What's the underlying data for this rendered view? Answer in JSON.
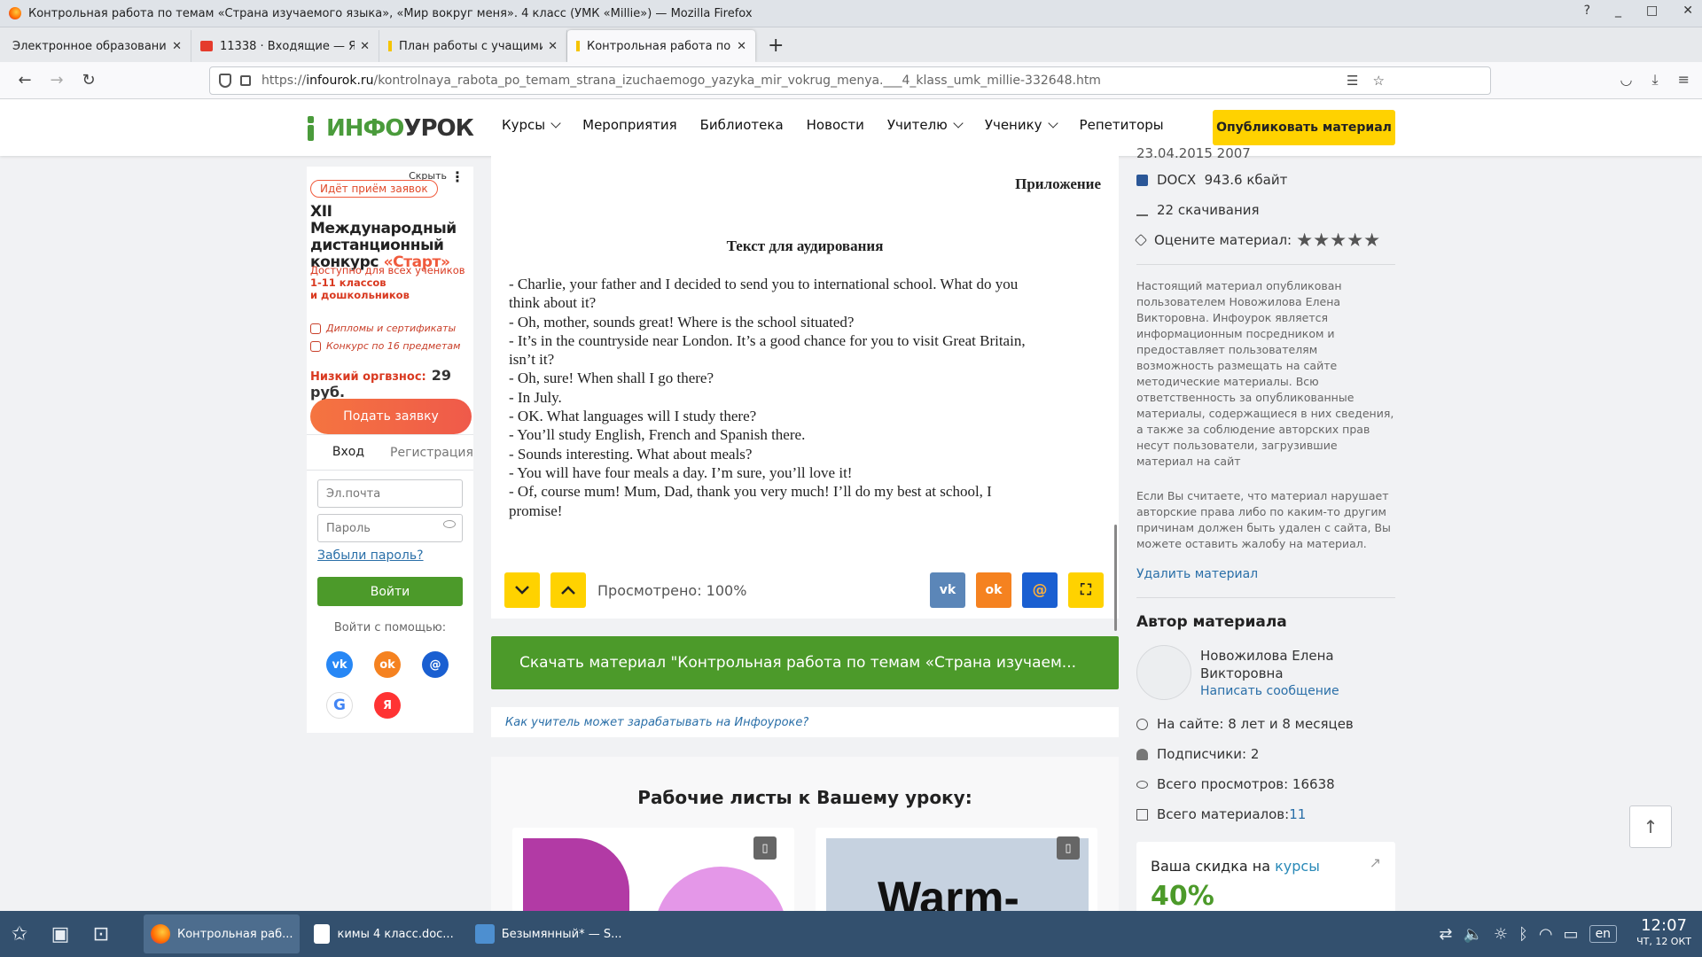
{
  "window": {
    "title": "Контрольная работа по темам «Страна изучаемого языка», «Мир вокруг меня». 4 класс (УМК «Millie») — Mozilla Firefox"
  },
  "tabs": [
    {
      "label": "Электронное образование Р",
      "active": false
    },
    {
      "label": "11338 · Входящие — Яндекс",
      "active": false
    },
    {
      "label": "План работы с учащимися",
      "active": false
    },
    {
      "label": "Контрольная работа по т",
      "active": true
    }
  ],
  "url": {
    "prefix": "https://",
    "host": "infourok.ru",
    "path": "/kontrolnaya_rabota_po_temam_strana_izuchaemogo_yazyka_mir_vokrug_menya.___4_klass_umk_millie-332648.htm"
  },
  "header": {
    "logo_left": "ИНФО",
    "logo_right": "УРОК",
    "menu": [
      {
        "label": "Курсы",
        "dropdown": true
      },
      {
        "label": "Мероприятия",
        "dropdown": false
      },
      {
        "label": "Библиотека",
        "dropdown": false
      },
      {
        "label": "Новости",
        "dropdown": false
      },
      {
        "label": "Учителю",
        "dropdown": true
      },
      {
        "label": "Ученику",
        "dropdown": true
      },
      {
        "label": "Репетиторы",
        "dropdown": false
      }
    ],
    "publish": "Опубликовать материал"
  },
  "ad": {
    "hide": "Скрыть",
    "pill": "Идёт приём заявок",
    "title_1": "XII Международный дистанционный конкурс ",
    "title_accent": "«Старт»",
    "avail_1": "Доступно для всех учеников",
    "avail_2": "1-11 классов",
    "avail_3": "и дошкольников",
    "feature_1": "Дипломы и сертификаты",
    "feature_2": "Конкурс по 16 предметам",
    "fee_label": "Низкий оргвзнос:",
    "fee_value": "29 руб.",
    "apply": "Подать заявку"
  },
  "login": {
    "tab_login": "Вход",
    "tab_register": "Регистрация",
    "email_placeholder": "Эл.почта",
    "password_placeholder": "Пароль",
    "forgot": "Забыли пароль?",
    "submit": "Войти",
    "via": "Войти с помощью:"
  },
  "document": {
    "appendix": "Приложение",
    "title": "Текст для аудирования",
    "lines": [
      "- Charlie, your father and I decided to send you to international school. What do you",
      "think about it?",
      "- Oh, mother, sounds great! Where is the school situated?",
      "- It’s in the countryside near London. It’s a good chance for you to visit Great Britain,",
      "isn’t it?",
      "- Oh, sure! When shall I go there?",
      "- In July.",
      "- OK. What languages will I study there?",
      "- You’ll study English, French and Spanish there.",
      "- Sounds interesting. What about meals?",
      "- You will have four meals a day. I’m sure, you’ll love it!",
      "- Of, course mum! Mum, Dad, thank you very much! I’ll do my best at school, I",
      "promise!"
    ],
    "viewed": "Просмотрено: 100%"
  },
  "download": "Скачать материал \"Контрольная работа по темам «Страна изучаем...",
  "earn_link": "Как учитель может зарабатывать на Инфоуроке?",
  "worksheets": {
    "title": "Рабочие листы к Вашему уроку:",
    "card2_text": "Warm-"
  },
  "sidebar": {
    "partial_top": "23.04.2015   2007",
    "format": "DOCX",
    "size": "943.6 кбайт",
    "downloads": "22 скачивания",
    "rate": "Оцените материал:",
    "disclaimer": "Настоящий материал опубликован пользователем Новожилова Елена Викторовна. Инфоурок является информационным посредником и предоставляет пользователям возможность размещать на сайте методические материалы. Всю ответственность за опубликованные материалы, содержащиеся в них сведения, а также за соблюдение авторских прав несут пользователи, загрузившие материал на сайт",
    "complaint": "Если Вы считаете, что материал нарушает авторские права либо по каким-то другим причинам должен быть удален с сайта, Вы можете оставить жалобу на материал.",
    "delete": "Удалить материал",
    "author_heading": "Автор материала",
    "author_name_1": "Новожилова Елена",
    "author_name_2": "Викторовна",
    "write": "Написать сообщение",
    "on_site": "На сайте: 8 лет и 8 месяцев",
    "subscribers": "Подписчики: 2",
    "views": "Всего просмотров: 16638",
    "materials_label": "Всего материалов: ",
    "materials_value": "11",
    "discount_label": "Ваша скидка на ",
    "discount_link": "курсы",
    "discount_value": "40%"
  },
  "taskbar": {
    "tasks": [
      "Контрольная раб...",
      "кимы 4 класс.doc...",
      "Безымянный* — S..."
    ],
    "lang": "en",
    "time": "12:07",
    "date": "ЧТ, 12 ОКТ"
  },
  "colors": {
    "brand_green": "#4c9a2a",
    "publish_yellow": "#ffd200",
    "taskbar": "#33506e",
    "link": "#2a6fa8"
  }
}
